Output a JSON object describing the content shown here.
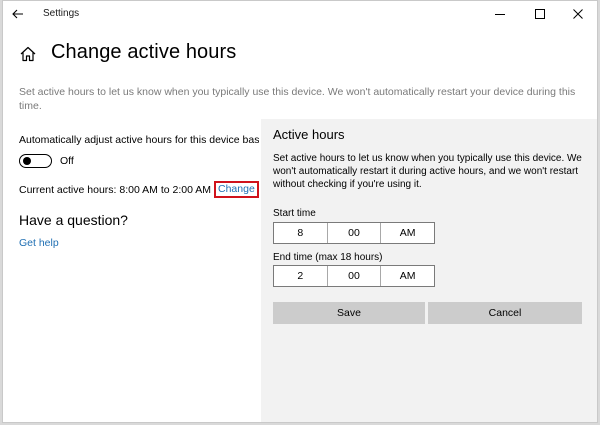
{
  "window": {
    "title": "Settings",
    "icons": {
      "back": "back-arrow-icon",
      "minimize": "minimize-icon",
      "maximize": "maximize-icon",
      "close": "close-icon"
    }
  },
  "page": {
    "title": "Change active hours",
    "home_icon": "home-icon",
    "description": "Set active hours to let us know when you typically use this device. We won't automatically restart your device during this time."
  },
  "left": {
    "auto_adjust_label": "Automatically adjust active hours for this device bas",
    "toggle_state": "Off",
    "current_hours": "Current active hours: 8:00 AM to 2:00 AM",
    "change_link": "Change",
    "question_heading": "Have a question?",
    "get_help_link": "Get help"
  },
  "panel": {
    "title": "Active hours",
    "description": "Set active hours to let us know when you typically use this device. We won't automatically restart it during active hours, and we won't restart without checking if you're using it.",
    "start_label": "Start time",
    "start": {
      "hour": "8",
      "minute": "00",
      "period": "AM"
    },
    "end_label": "End time (max 18 hours)",
    "end": {
      "hour": "2",
      "minute": "00",
      "period": "AM"
    },
    "save_label": "Save",
    "cancel_label": "Cancel"
  },
  "colors": {
    "link": "#1f6fb3",
    "highlight_border": "#d0121b",
    "panel_bg": "#f2f2f2",
    "button_bg": "#cccccc"
  }
}
